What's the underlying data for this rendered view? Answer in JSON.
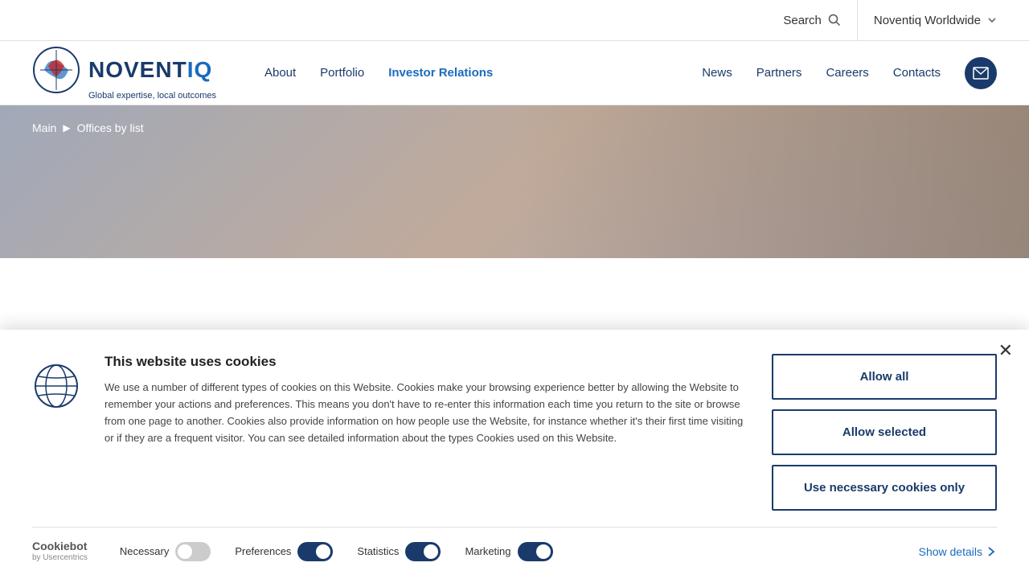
{
  "topbar": {
    "search_label": "Search",
    "region_label": "Noventiq Worldwide"
  },
  "nav": {
    "logo_name": "NOVENTIQ",
    "logo_tagline": "Global expertise, local outcomes",
    "links": [
      {
        "label": "About",
        "active": false
      },
      {
        "label": "Portfolio",
        "active": false
      },
      {
        "label": "Investor Relations",
        "active": true
      },
      {
        "label": "News",
        "active": false
      },
      {
        "label": "Partners",
        "active": false
      },
      {
        "label": "Careers",
        "active": false
      },
      {
        "label": "Contacts",
        "active": false
      }
    ]
  },
  "breadcrumb": {
    "main": "Main",
    "current": "Offices by list"
  },
  "cookie": {
    "title": "This website uses cookies",
    "description": "We use a number of different types of cookies on this Website. Cookies make your browsing experience better by allowing the Website to remember your actions and preferences. This means you don't have to re-enter this information each time you return to the site or browse from one page to another. Cookies also provide information on how people use the Website, for instance whether it's their first time visiting or if they are a frequent visitor. You can see detailed information about the types Cookies used on this Website.",
    "btn_allow_all": "Allow all",
    "btn_allow_selected": "Allow selected",
    "btn_necessary": "Use necessary cookies only",
    "footer": {
      "cookiebot_main": "Cookiebot",
      "cookiebot_sub": "by Usercentrics",
      "necessary_label": "Necessary",
      "preferences_label": "Preferences",
      "statistics_label": "Statistics",
      "marketing_label": "Marketing",
      "show_details_label": "Show details"
    }
  }
}
